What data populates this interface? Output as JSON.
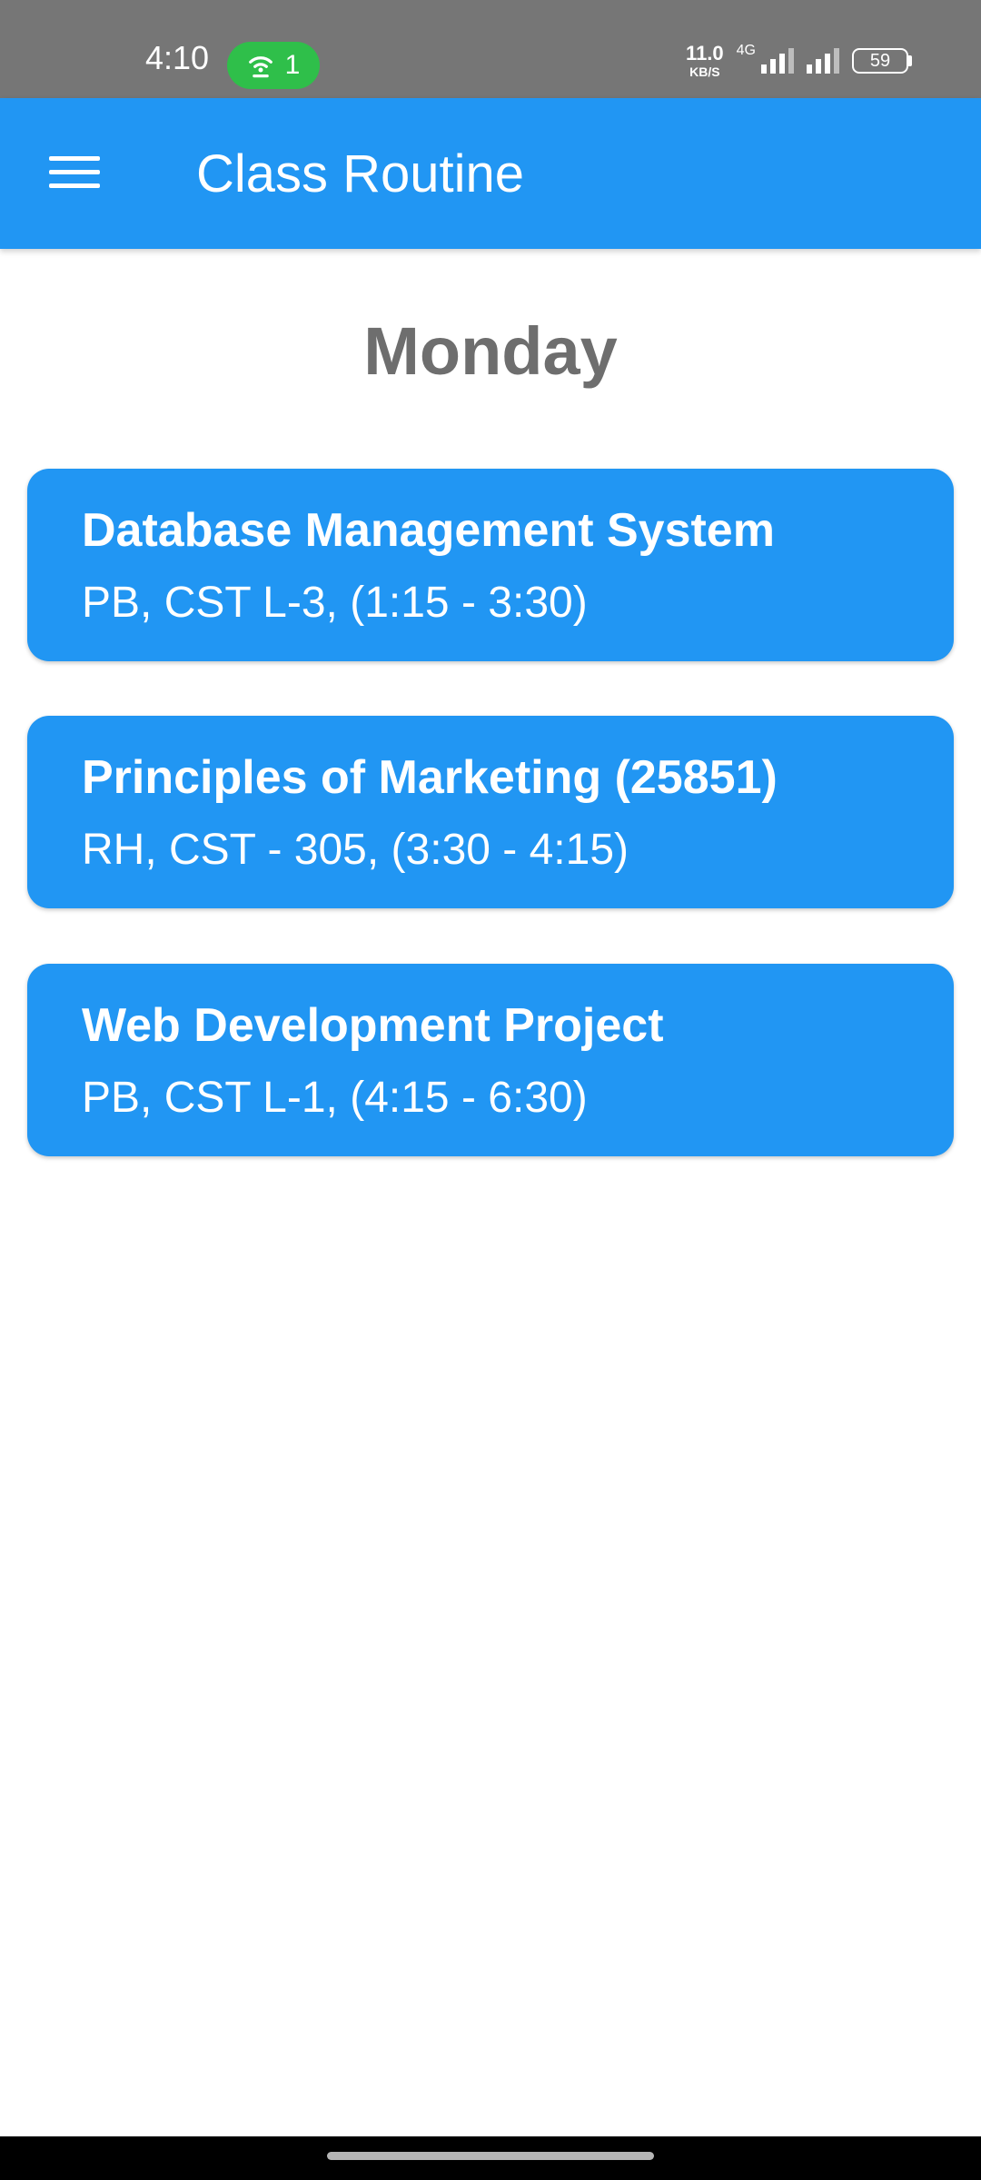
{
  "status_bar": {
    "time": "4:10",
    "hotspot_count": "1",
    "net_speed_value": "11.0",
    "net_speed_unit": "KB/S",
    "network_type": "4G",
    "battery": "59"
  },
  "app_bar": {
    "title": "Class Routine",
    "menu_icon": "hamburger-menu-icon"
  },
  "day": "Monday",
  "classes": [
    {
      "title": "Database Management System",
      "details": "PB, CST L-3, (1:15 - 3:30)"
    },
    {
      "title": "Principles of Marketing (25851)",
      "details": "RH, CST - 305, (3:30 - 4:15)"
    },
    {
      "title": "Web Development Project",
      "details": "PB, CST L-1, (4:15 - 6:30)"
    }
  ],
  "colors": {
    "primary": "#2196f3",
    "status_bar": "#767676",
    "hotspot": "#2fbf4a",
    "day_heading": "#6e6e6e"
  }
}
